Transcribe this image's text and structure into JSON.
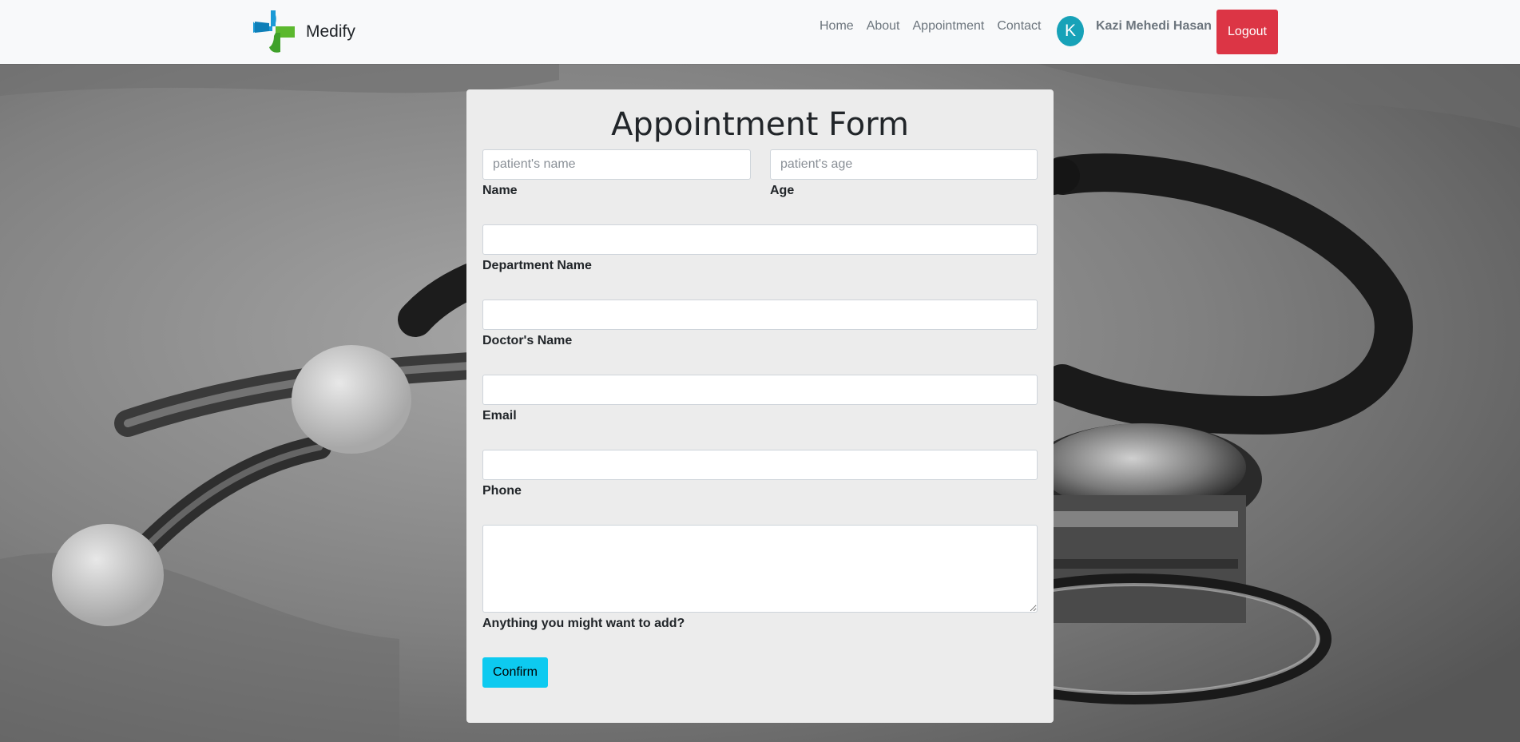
{
  "navbar": {
    "brand": "Medify",
    "links": [
      "Home",
      "About",
      "Appointment",
      "Contact"
    ],
    "avatar_initial": "K",
    "user_name": "Kazi Mehedi Hasan",
    "logout_label": "Logout"
  },
  "form": {
    "title": "Appointment Form",
    "name": {
      "placeholder": "patient's name",
      "label": "Name"
    },
    "age": {
      "placeholder": "patient's age",
      "label": "Age"
    },
    "department": {
      "label": "Department Name"
    },
    "doctor": {
      "label": "Doctor's Name"
    },
    "email": {
      "label": "Email"
    },
    "phone": {
      "label": "Phone"
    },
    "notes": {
      "label": "Anything you might want to add?"
    },
    "confirm_label": "Confirm"
  },
  "colors": {
    "logout": "#dc3545",
    "avatar": "#17a2b8",
    "confirm": "#0dcaf0",
    "logo_blue": "#1a9ad6",
    "logo_green": "#5cb82e"
  },
  "icons": {
    "logo": "medical-cross-logo-icon"
  }
}
